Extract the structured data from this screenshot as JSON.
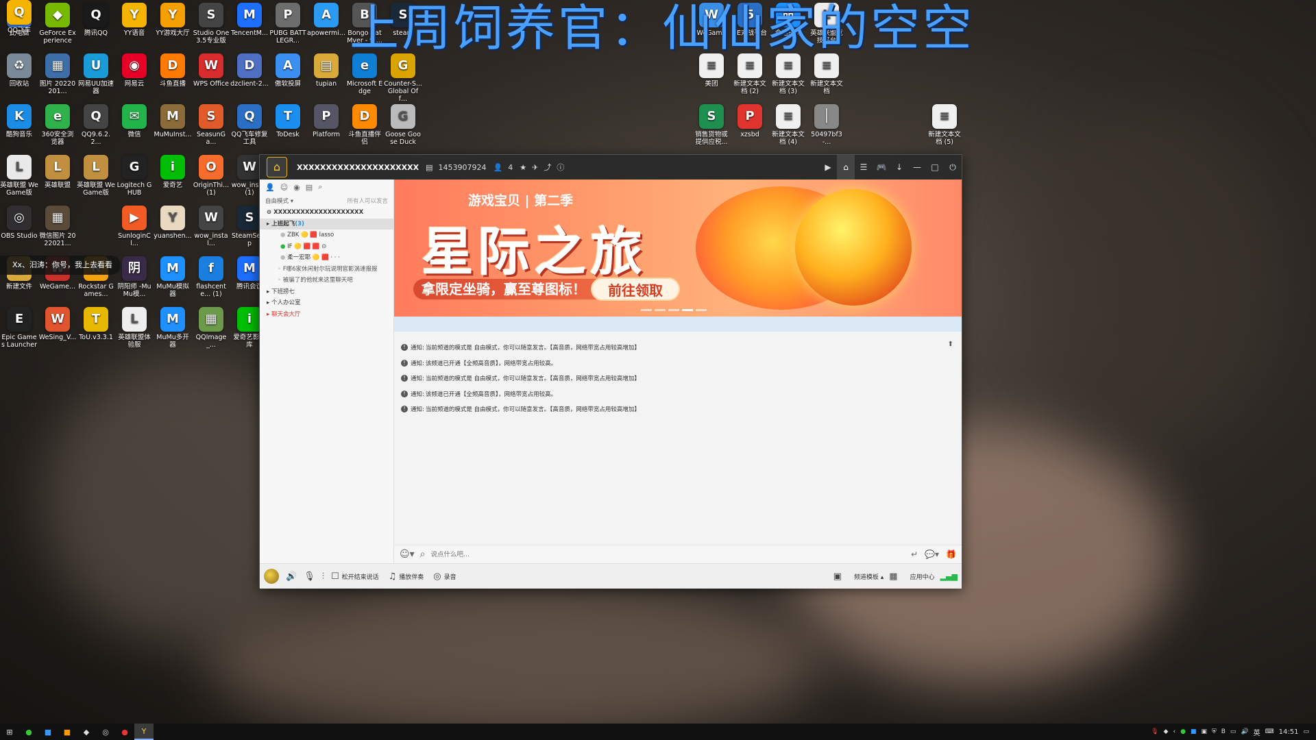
{
  "overlay": {
    "title": "上周饲养官：仙仙家的空空"
  },
  "desktop": {
    "icons": [
      {
        "label": "此电脑",
        "icon": "computer-icon",
        "color": "#3a7bd5",
        "glyph": "▭"
      },
      {
        "label": "GeForce Experience",
        "icon": "geforce-icon",
        "color": "#76b900",
        "glyph": "◆"
      },
      {
        "label": "腾讯QQ",
        "icon": "qq-icon",
        "color": "#1a1a1a",
        "glyph": "Q"
      },
      {
        "label": "YY语音",
        "icon": "yy-icon",
        "color": "#f5b400",
        "glyph": "Y"
      },
      {
        "label": "YY游戏大厅",
        "icon": "yy-game-icon",
        "color": "#f5a000",
        "glyph": "Y"
      },
      {
        "label": "Studio One 3.5专业版",
        "icon": "studio-one-icon",
        "color": "#444",
        "glyph": "S"
      },
      {
        "label": "TencentM...",
        "icon": "tencent-meeting-icon",
        "color": "#1e6fff",
        "glyph": "M"
      },
      {
        "label": "PUBG BATTLEGR...",
        "icon": "pubg-icon",
        "color": "#6d6d6d",
        "glyph": "P"
      },
      {
        "label": "apowermi...",
        "icon": "apowermirror-icon",
        "color": "#2b9af3",
        "glyph": "A"
      },
      {
        "label": "Bongo Cat Mver - 快...",
        "icon": "bongo-cat-icon",
        "color": "#555",
        "glyph": "B"
      },
      {
        "label": "steam",
        "icon": "steam-icon",
        "color": "#1b2838",
        "glyph": "S"
      },
      {
        "label": "回收站",
        "icon": "recycle-bin-icon",
        "color": "#7a8a99",
        "glyph": "♻"
      },
      {
        "label": "图片 20220201...",
        "icon": "image-file-icon",
        "color": "#3e6ea8",
        "glyph": "▦"
      },
      {
        "label": "网易UU加速器",
        "icon": "uu-icon",
        "color": "#1a9ad6",
        "glyph": "U"
      },
      {
        "label": "网易云",
        "icon": "netease-music-icon",
        "color": "#e60026",
        "glyph": "◉"
      },
      {
        "label": "斗鱼直播",
        "icon": "douyu-icon",
        "color": "#ff7a00",
        "glyph": "D"
      },
      {
        "label": "WPS Office",
        "icon": "wps-icon",
        "color": "#d92c2c",
        "glyph": "W"
      },
      {
        "label": "dzclient-2...",
        "icon": "dzclient-icon",
        "color": "#4f6fc4",
        "glyph": "D"
      },
      {
        "label": "傲软投屏",
        "icon": "aoruan-icon",
        "color": "#3b8ff0",
        "glyph": "A"
      },
      {
        "label": "tupian",
        "icon": "folder-icon",
        "color": "#d9a93a",
        "glyph": "▤"
      },
      {
        "label": "Microsoft Edge",
        "icon": "edge-icon",
        "color": "#0f7fd6",
        "glyph": "e"
      },
      {
        "label": "Counter-S... Global Off...",
        "icon": "csgo-icon",
        "color": "#d9a400",
        "glyph": "G"
      },
      {
        "label": "酷狗音乐",
        "icon": "kugou-icon",
        "color": "#1b8de6",
        "glyph": "K"
      },
      {
        "label": "360安全浏览器",
        "icon": "360-browser-icon",
        "color": "#2fb24a",
        "glyph": "e"
      },
      {
        "label": "QQ9.6.2.2...",
        "icon": "qq-installer-icon",
        "color": "#444",
        "glyph": "Q"
      },
      {
        "label": "微信",
        "icon": "wechat-icon",
        "color": "#22b34a",
        "glyph": "✉"
      },
      {
        "label": "MuMuInst...",
        "icon": "mumu-installer-icon",
        "color": "#8c6b3a",
        "glyph": "M"
      },
      {
        "label": "SeasunGa...",
        "icon": "seasun-icon",
        "color": "#e05a2a",
        "glyph": "S"
      },
      {
        "label": "QQ飞车修复工具",
        "icon": "qq-speed-repair-icon",
        "color": "#2a6fc4",
        "glyph": "Q"
      },
      {
        "label": "ToDesk",
        "icon": "todesk-icon",
        "color": "#1b8ff0",
        "glyph": "T"
      },
      {
        "label": "Platform",
        "icon": "platform-icon",
        "color": "#556",
        "glyph": "P"
      },
      {
        "label": "斗鱼直播伴侣",
        "icon": "douyu-helper-icon",
        "color": "#ff8a00",
        "glyph": "D"
      },
      {
        "label": "Goose Goose Duck",
        "icon": "goose-duck-icon",
        "color": "#bbb",
        "glyph": "G"
      },
      {
        "label": "英雄联盟 WeGame版",
        "icon": "lol-wegame-icon",
        "color": "#e9e9e9",
        "glyph": "L"
      },
      {
        "label": "英雄联盟",
        "icon": "lol-icon",
        "color": "#c09040",
        "glyph": "L"
      },
      {
        "label": "英雄联盟 WeGame版",
        "icon": "lol-wegame2-icon",
        "color": "#c09040",
        "glyph": "L"
      },
      {
        "label": "Logitech G HUB",
        "icon": "logitech-icon",
        "color": "#222",
        "glyph": "G"
      },
      {
        "label": "爱奇艺",
        "icon": "iqiyi-icon",
        "color": "#00be06",
        "glyph": "i"
      },
      {
        "label": "OriginThi... (1)",
        "icon": "origin-icon",
        "color": "#f56c2d",
        "glyph": "O"
      },
      {
        "label": "wow_inst... (1)",
        "icon": "wow-installer-icon",
        "color": "#333",
        "glyph": "W"
      },
      {
        "label": "OBS Studio",
        "icon": "obs-icon",
        "color": "#302e31",
        "glyph": "◎"
      },
      {
        "label": "微信图片 2022021...",
        "icon": "wechat-image-icon",
        "color": "#5a4a3a",
        "glyph": "▦"
      },
      {
        "label": "Xx、",
        "icon": "toast-avatar-icon",
        "color": "#2a2a2a",
        "glyph": "X"
      },
      {
        "label": "SunloginCl...",
        "icon": "sunlogin-icon",
        "color": "#f25c24",
        "glyph": "▶"
      },
      {
        "label": "yuanshen...",
        "icon": "yuanshen-icon",
        "color": "#e8d9c0",
        "glyph": "Y"
      },
      {
        "label": "wow_instal...",
        "icon": "wow-installer2-icon",
        "color": "#444",
        "glyph": "W"
      },
      {
        "label": "SteamSetup",
        "icon": "steam-setup-icon",
        "color": "#1b2838",
        "glyph": "S"
      },
      {
        "label": "新建文件",
        "icon": "new-folder-icon",
        "color": "#d9a93a",
        "glyph": "▤"
      },
      {
        "label": "WeGame...",
        "icon": "wegame-icon",
        "color": "#c9302c",
        "glyph": "W"
      },
      {
        "label": "Rockstar Games...",
        "icon": "rockstar-icon",
        "color": "#f2a20c",
        "glyph": "R"
      },
      {
        "label": "阴阳师 -MuMu模...",
        "icon": "onmyoji-icon",
        "color": "#3a2a4a",
        "glyph": "阴"
      },
      {
        "label": "MuMu模拟器",
        "icon": "mumu-icon",
        "color": "#1e90ff",
        "glyph": "M"
      },
      {
        "label": "flashcente... (1)",
        "icon": "flash-center-icon",
        "color": "#1a7fe0",
        "glyph": "f"
      },
      {
        "label": "腾讯会议",
        "icon": "tencent-meeting2-icon",
        "color": "#1e6fff",
        "glyph": "M"
      },
      {
        "label": "Epic Games Launcher",
        "icon": "epic-icon",
        "color": "#222",
        "glyph": "E"
      },
      {
        "label": "WeSing_V...",
        "icon": "wesing-icon",
        "color": "#e0542f",
        "glyph": "W"
      },
      {
        "label": "ToU.v3.3.1",
        "icon": "tou-icon",
        "color": "#e6b800",
        "glyph": "T"
      },
      {
        "label": "英雄联盟体验服",
        "icon": "lol-pbe-icon",
        "color": "#eee",
        "glyph": "L"
      },
      {
        "label": "MuMu多开器",
        "icon": "mumu-multi-icon",
        "color": "#1e90ff",
        "glyph": "M"
      },
      {
        "label": "QQImage_...",
        "icon": "qqimage-icon",
        "color": "#6a9a4a",
        "glyph": "▦"
      },
      {
        "label": "爱奇艺影视库",
        "icon": "iqiyi-library-icon",
        "color": "#00be06",
        "glyph": "i"
      },
      {
        "label": "QQ飞车",
        "icon": "qq-speed-icon",
        "color": "#f5b400",
        "glyph": "Q"
      },
      {
        "label": "WeGame",
        "icon": "wegame-right-icon",
        "color": "#3a8ee6",
        "glyph": "W"
      },
      {
        "label": "5E对战平台",
        "icon": "5e-icon",
        "color": "#2a6fc4",
        "glyph": "5"
      },
      {
        "label": "命运战网",
        "icon": "fate-icon",
        "color": "#1e90ff",
        "glyph": "命"
      },
      {
        "label": "英雄联盟竞技平台",
        "icon": "lol-arena-icon",
        "color": "#eee",
        "glyph": "L"
      },
      {
        "label": "美团",
        "icon": "text-file-icon",
        "color": "#f0f0f0",
        "glyph": "≡"
      },
      {
        "label": "新建文本文档 (2)",
        "icon": "text-file2-icon",
        "color": "#f0f0f0",
        "glyph": "≡"
      },
      {
        "label": "新建文本文档 (3)",
        "icon": "text-file3-icon",
        "color": "#f0f0f0",
        "glyph": "≡"
      },
      {
        "label": "新建文本文档",
        "icon": "text-file4-icon",
        "color": "#f0f0f0",
        "glyph": "≡"
      },
      {
        "label": "销售货物或提供应税...",
        "icon": "excel-icon",
        "color": "#1f8f4f",
        "glyph": "S"
      },
      {
        "label": "xzsbd",
        "icon": "pdf-icon",
        "color": "#e0342f",
        "glyph": "P"
      },
      {
        "label": "新建文本文档 (4)",
        "icon": "text-file5-icon",
        "color": "#f0f0f0",
        "glyph": "≡"
      },
      {
        "label": "50497bf3-...",
        "icon": "unknown-file-icon",
        "color": "#888",
        "glyph": "│"
      },
      {
        "label": "新建文本文档 (5)",
        "icon": "text-file6-icon",
        "color": "#f0f0f0",
        "glyph": "≡"
      }
    ],
    "toast": "Xx、汩涛：你号，我上去看看"
  },
  "window": {
    "room_name": "XXXXXXXXXXXXXXXXXXXXX",
    "room_id": "1453907924",
    "online_count": "4",
    "side": {
      "mode": "自由模式",
      "permission": "所有人可以发言",
      "channel_title": "XXXXXXXXXXXXXXXXXXXX",
      "items": [
        {
          "label": "上班起飞",
          "count": "(3)",
          "cls": "top sel"
        },
        {
          "label": "ZBK 🟡 🟥 lasso",
          "count": "",
          "cls": "l2"
        },
        {
          "label": "IF 🟡 🟥 🟥 ⊙",
          "count": "",
          "cls": "l2"
        },
        {
          "label": "柔一宏耶 🟡 🟥 ·  ·  ·",
          "count": "",
          "cls": "l2"
        },
        {
          "label": "F哪6家休闲射尔玩说明官影涡速报报",
          "count": "",
          "cls": "l3"
        },
        {
          "label": "被骗了的他就来这里聊天吧",
          "count": "",
          "cls": "l3"
        },
        {
          "label": "下班捞七",
          "count": "",
          "cls": ""
        },
        {
          "label": "个人办公室",
          "count": "",
          "cls": ""
        },
        {
          "label": "聊天会大厅",
          "count": "",
          "cls": "red"
        }
      ]
    },
    "banner": {
      "sub": "游戏宝贝 | 第二季",
      "big": "星际之旅",
      "tag": "拿限定坐骑，赢至尊图标！",
      "cta": "前往领取"
    },
    "messages": [
      {
        "prefix": "通知:",
        "text": "当前频道的模式是 自由模式，你可以随意发言。【高音质，网络带宽占用较高增加】"
      },
      {
        "prefix": "通知:",
        "text": "该频道已开通【全频高音质】，网络带宽占用较高。"
      },
      {
        "prefix": "通知:",
        "text": "当前频道的模式是 自由模式，你可以随意发言。【高音质，网络带宽占用较高增加】"
      },
      {
        "prefix": "通知:",
        "text": "该频道已开通【全频高音质】，网络带宽占用较高。"
      },
      {
        "prefix": "通知:",
        "text": "当前频道的模式是 自由模式，你可以随意发言。【高音质，网络带宽占用较高增加】"
      }
    ],
    "input_placeholder": "说点什么吧...",
    "footer": {
      "release_mic": "松开结束说话",
      "play_music": "播放伴奏",
      "record": "录音",
      "channel_template": "频道模板",
      "app_center": "应用中心"
    }
  },
  "taskbar": {
    "time": "14:51",
    "ime": "英"
  }
}
